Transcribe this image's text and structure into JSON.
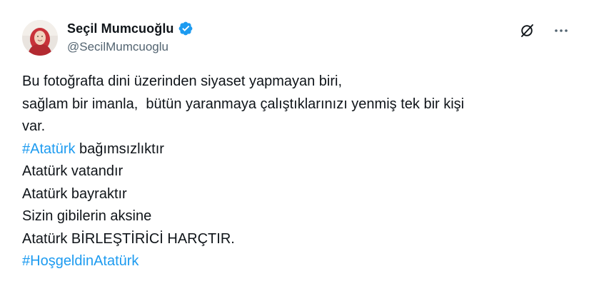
{
  "author": {
    "display_name": "Seçil Mumcuoğlu",
    "handle": "@SecilMumcuoglu",
    "verified": true
  },
  "actions": {
    "grok_icon": "grok-icon",
    "more_icon": "more-icon"
  },
  "tweet": {
    "lines": [
      {
        "text": "Bu fotoğrafta dini üzerinden siyaset yapmayan biri,"
      },
      {
        "text": "sağlam bir imanla,  bütün yaranmaya çalıştıklarınızı yenmiş tek bir kişi"
      },
      {
        "text": "var."
      },
      {
        "hashtag": "#Atatürk",
        "text": " bağımsızlıktır"
      },
      {
        "text": "Atatürk vatandır"
      },
      {
        "text": "Atatürk bayraktır"
      },
      {
        "text": "Sizin gibilerin aksine"
      },
      {
        "text": "Atatürk BİRLEŞTİRİCİ HARÇTIR."
      },
      {
        "hashtag": "#HoşgeldinAtatürk",
        "text": ""
      }
    ]
  },
  "colors": {
    "text": "#0f1419",
    "secondary": "#536471",
    "link": "#1d9bf0",
    "verified": "#1d9bf0"
  }
}
